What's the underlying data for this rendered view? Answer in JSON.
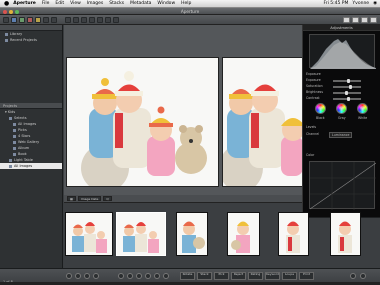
{
  "menubar": {
    "apple": "",
    "items": [
      "Aperture",
      "File",
      "Edit",
      "View",
      "Images",
      "Stacks",
      "Metadata",
      "Window",
      "Help"
    ],
    "clock": "Fri 5:45 PM",
    "user": "Yvonne"
  },
  "window": {
    "title": "Aperture"
  },
  "projects": {
    "header": "Projects",
    "library_rows": [
      {
        "label": "Library",
        "count": ""
      },
      {
        "label": "Recent Projects",
        "count": ""
      }
    ],
    "rows": [
      {
        "label": "Kids",
        "count": "",
        "level": 0
      },
      {
        "label": "Selects",
        "count": "",
        "level": 1
      },
      {
        "label": "All Images",
        "count": "",
        "level": 1
      },
      {
        "label": "Picks",
        "count": "",
        "level": 1
      },
      {
        "label": "4 Stars",
        "count": "",
        "level": 1
      },
      {
        "label": "Web Gallery",
        "count": "",
        "level": 1
      },
      {
        "label": "Album",
        "count": "",
        "level": 1
      },
      {
        "label": "Book",
        "count": "",
        "level": 1
      },
      {
        "label": "Light Table",
        "count": "",
        "level": 1
      },
      {
        "label": "All Images",
        "count": "",
        "level": 1,
        "selected": true
      }
    ]
  },
  "hud": {
    "title": "Adjustments",
    "sections": [
      "Exposure",
      "Levels",
      "Color"
    ],
    "sliders": [
      "Exposure",
      "Saturation",
      "Brightness",
      "Contrast"
    ],
    "wheels": [
      "Black",
      "Gray",
      "White"
    ],
    "levels_label": "Channel",
    "levels_value": "Luminance"
  },
  "filmstrip": {
    "sort_label": "Image Date",
    "filter_label": "Q"
  },
  "bottom": {
    "status": "1 of 8",
    "buttons": [
      "Rotate",
      "Stack",
      "Pick",
      "Reject",
      "Rating",
      "Keyword",
      "Loupe",
      "Print"
    ]
  },
  "colors": {
    "accent": "#5d7fb0",
    "selection": "#e9e9e9"
  }
}
